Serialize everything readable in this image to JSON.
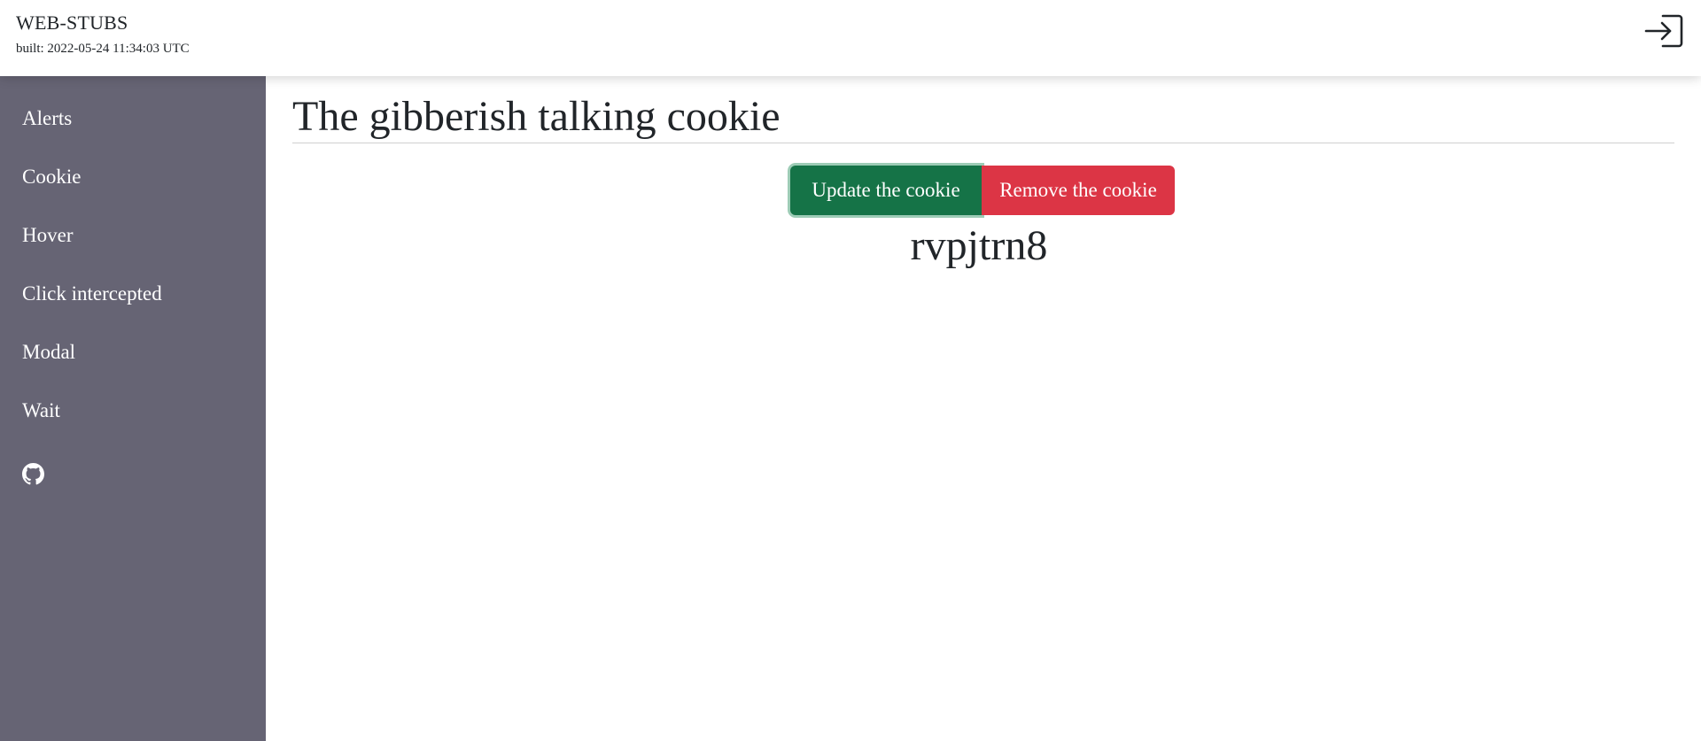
{
  "app": {
    "brand": "WEB-STUBS",
    "built": "built: 2022-05-24 11:34:03 UTC",
    "login_icon": "sign-in-icon"
  },
  "sidebar": {
    "items": [
      {
        "label": "Alerts"
      },
      {
        "label": "Cookie"
      },
      {
        "label": "Hover"
      },
      {
        "label": "Click intercepted"
      },
      {
        "label": "Modal"
      },
      {
        "label": "Wait"
      }
    ],
    "github_icon": "github-icon"
  },
  "main": {
    "title": "The gibberish talking cookie",
    "update_label": "Update the cookie",
    "remove_label": "Remove the cookie",
    "cookie_value": "rvpjtrn8"
  },
  "colors": {
    "sidebar_bg": "#666474",
    "update_button": "#157347",
    "remove_button": "#dc3545"
  }
}
